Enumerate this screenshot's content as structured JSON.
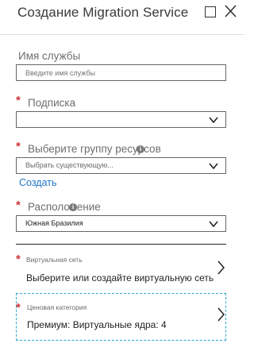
{
  "window": {
    "title": "Создание Migration Service",
    "maximize_icon": "maximize-icon",
    "close_icon": "close-icon"
  },
  "form": {
    "service_name": {
      "label": "Имя службы",
      "value": "",
      "placeholder": "Введите имя службы"
    },
    "subscription": {
      "label": "Подписка",
      "required": true,
      "value": ""
    },
    "resource_group": {
      "label": "Выберите группу ресурсов",
      "required": true,
      "info_icon": "info-icon",
      "value": "Выбрать существующую...",
      "create_link": "Создать"
    },
    "location": {
      "label": "Расположение",
      "required": true,
      "info_icon": "info-icon",
      "value": "Южная Бразилия"
    },
    "virtual_network": {
      "label": "Виртуальная сеть",
      "required": true,
      "value": "Выберите или создайте виртуальную сеть"
    },
    "pricing_tier": {
      "label": "Ценовая категория",
      "required": true,
      "value": "Премиум: Виртуальные ядра: 4"
    }
  },
  "colors": {
    "required_star": "#d13438",
    "link": "#2176c9",
    "focus_border": "#2aa6c9"
  }
}
